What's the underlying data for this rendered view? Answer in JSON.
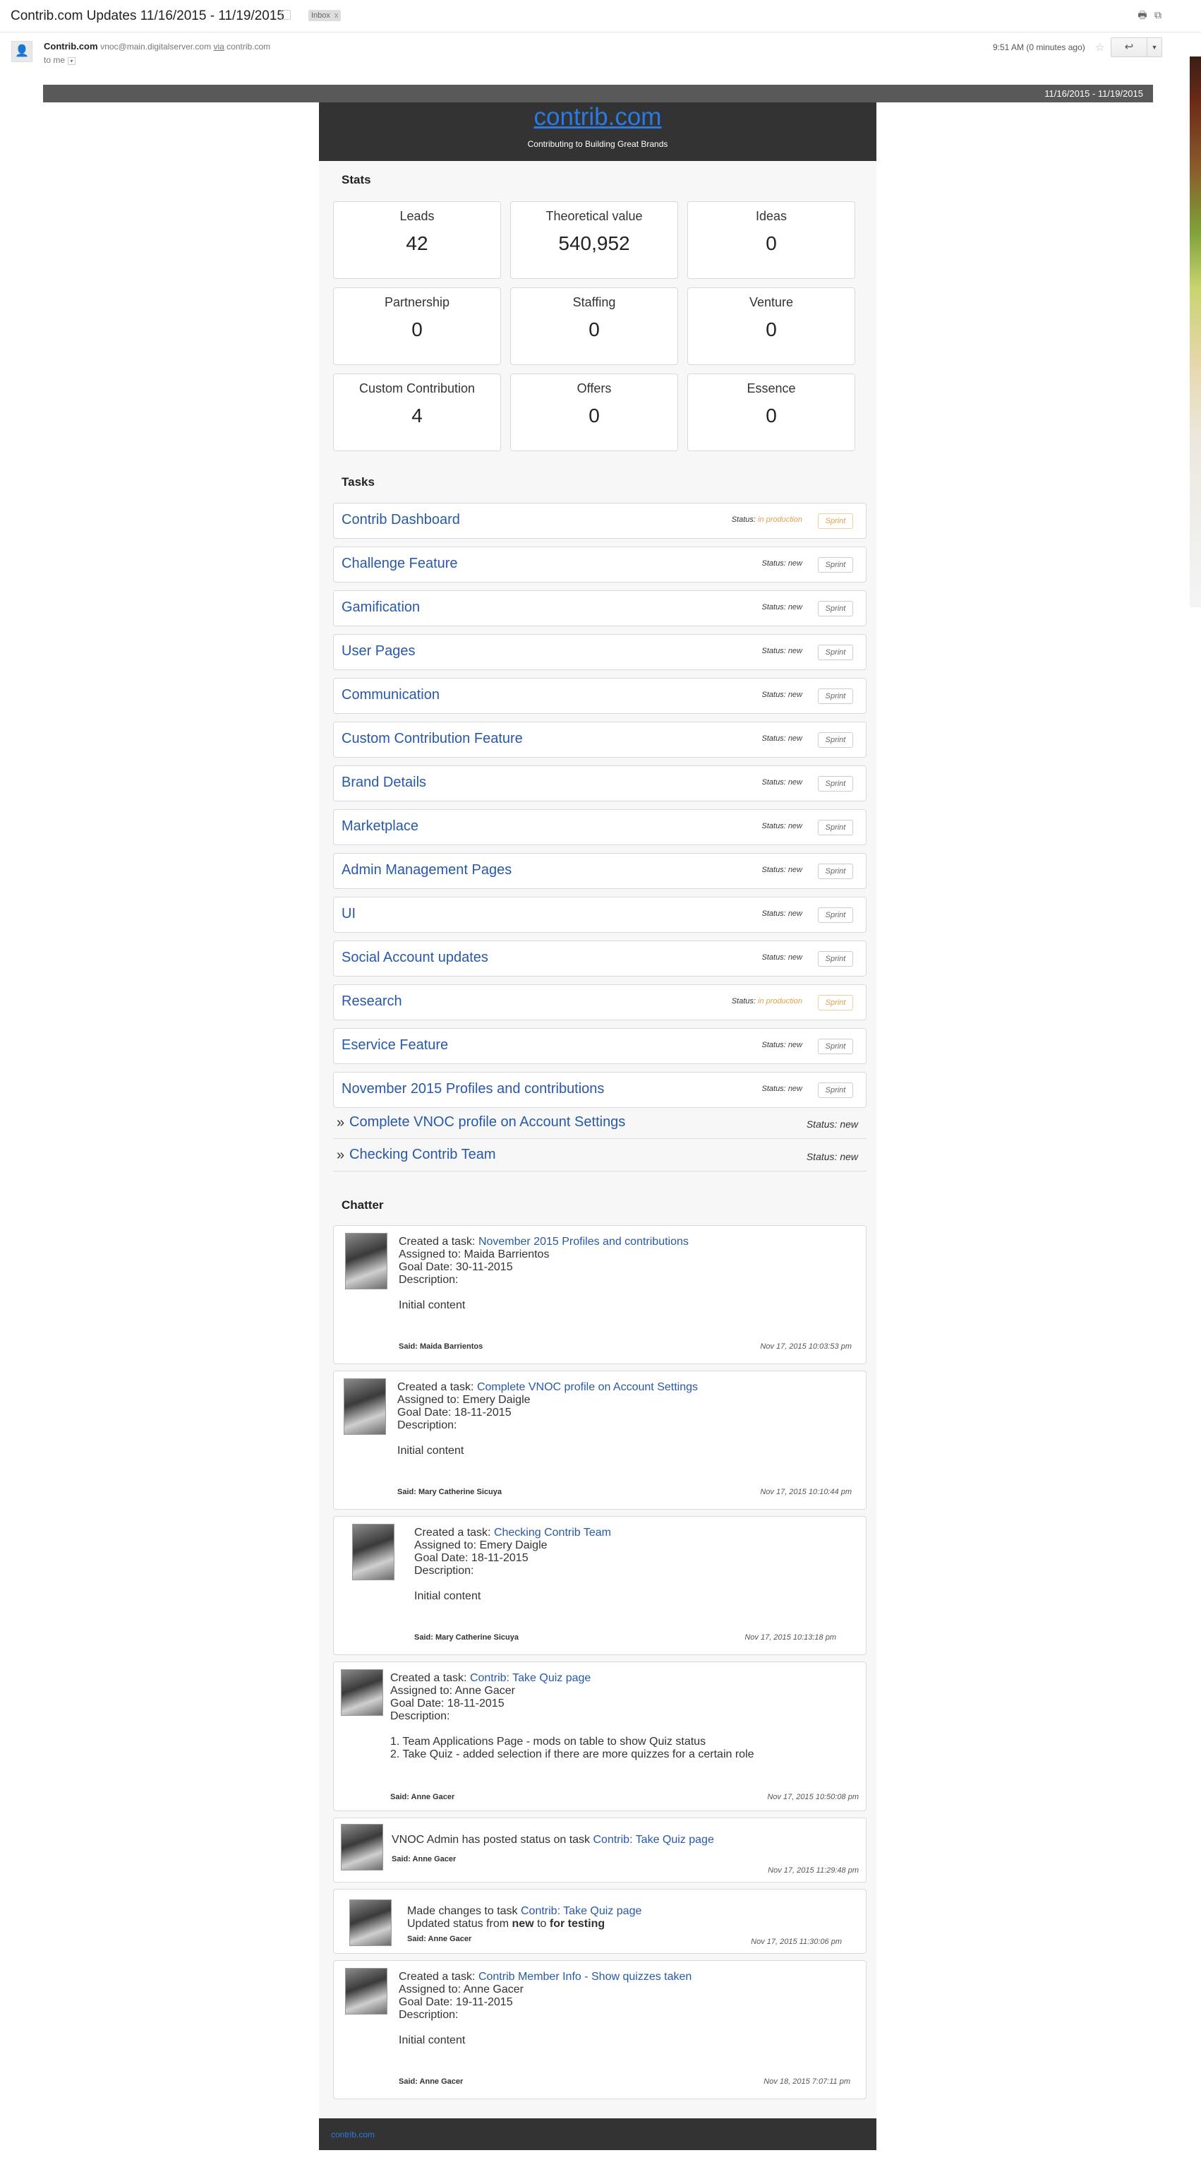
{
  "window": {
    "subject": "Contrib.com Updates 11/16/2015 - 11/19/2015",
    "label": "Inbox",
    "label_close": "x"
  },
  "sender": {
    "name": "Contrib.com",
    "email": "vnoc@main.digitalserver.com",
    "via": "via",
    "via_domain": "contrib.com",
    "to": "to me",
    "time": "9:51 AM (0 minutes ago)"
  },
  "email": {
    "date_range": "11/16/2015 - 11/19/2015",
    "brand": "contrib.com",
    "tagline": "Contributing to Building Great Brands",
    "footer_link": "contrib.com"
  },
  "stats": {
    "title": "Stats",
    "items": [
      {
        "label": "Leads",
        "value": "42"
      },
      {
        "label": "Theoretical value",
        "value": "540,952"
      },
      {
        "label": "Ideas",
        "value": "0"
      },
      {
        "label": "Partnership",
        "value": "0"
      },
      {
        "label": "Staffing",
        "value": "0"
      },
      {
        "label": "Venture",
        "value": "0"
      },
      {
        "label": "Custom Contribution",
        "value": "4"
      },
      {
        "label": "Offers",
        "value": "0"
      },
      {
        "label": "Essence",
        "value": "0"
      }
    ]
  },
  "tasks": {
    "title": "Tasks",
    "status_label": "Status:",
    "items": [
      {
        "title": "Contrib Dashboard",
        "status": "in production",
        "badge": "Sprint"
      },
      {
        "title": "Challenge Feature",
        "status": "new",
        "badge": "Sprint"
      },
      {
        "title": "Gamification",
        "status": "new",
        "badge": "Sprint"
      },
      {
        "title": "User Pages",
        "status": "new",
        "badge": "Sprint"
      },
      {
        "title": "Communication",
        "status": "new",
        "badge": "Sprint"
      },
      {
        "title": "Custom Contribution Feature",
        "status": "new",
        "badge": "Sprint"
      },
      {
        "title": "Brand Details",
        "status": "new",
        "badge": "Sprint"
      },
      {
        "title": "Marketplace",
        "status": "new",
        "badge": "Sprint"
      },
      {
        "title": "Admin Management Pages",
        "status": "new",
        "badge": "Sprint"
      },
      {
        "title": "UI",
        "status": "new",
        "badge": "Sprint"
      },
      {
        "title": "Social Account updates",
        "status": "new",
        "badge": "Sprint"
      },
      {
        "title": "Research",
        "status": "in production",
        "badge": "Sprint"
      },
      {
        "title": "Eservice Feature",
        "status": "new",
        "badge": "Sprint"
      },
      {
        "title": "November 2015 Profiles and contributions",
        "status": "new",
        "badge": "Sprint"
      }
    ],
    "subtasks": [
      {
        "arrow": "»",
        "title": "Complete VNOC profile on Account Settings",
        "status": "Status: new"
      },
      {
        "arrow": "»",
        "title": "Checking Contrib Team",
        "status": "Status: new"
      }
    ]
  },
  "chatter": {
    "title": "Chatter",
    "items": [
      {
        "prefix": "Created a task:",
        "link": "November 2015 Profiles and contributions",
        "assigned": "Assigned to: Maida Barrientos",
        "goal": "Goal Date: 30-11-2015",
        "desc_label": "Description:",
        "desc": "Initial content",
        "said": "Said: Maida Barrientos",
        "time": "Nov 17, 2015 10:03:53 pm"
      },
      {
        "prefix": "Created a task:",
        "link": "Complete VNOC profile on Account Settings",
        "assigned": "Assigned to: Emery Daigle",
        "goal": "Goal Date: 18-11-2015",
        "desc_label": "Description:",
        "desc": "Initial content",
        "said": "Said: Mary Catherine Sicuya",
        "time": "Nov 17, 2015 10:10:44 pm"
      },
      {
        "prefix": "Created a task:",
        "link": "Checking Contrib Team",
        "assigned": "Assigned to: Emery Daigle",
        "goal": "Goal Date: 18-11-2015",
        "desc_label": "Description:",
        "desc": "Initial content",
        "said": "Said: Mary Catherine Sicuya",
        "time": "Nov 17, 2015 10:13:18 pm"
      },
      {
        "prefix": "Created a task:",
        "link": "Contrib: Take Quiz page",
        "assigned": "Assigned to: Anne Gacer",
        "goal": "Goal Date: 18-11-2015",
        "desc_label": "Description:",
        "desc_line1": "1. Team Applications Page - mods on table to show Quiz status",
        "desc_line2": "2. Take Quiz - added selection if there are more quizzes for a certain role",
        "said": "Said: Anne Gacer",
        "time": "Nov 17, 2015 10:50:08 pm"
      },
      {
        "prefix": "VNOC Admin has posted status on task",
        "link": "Contrib: Take Quiz page",
        "said": "Said: Anne Gacer",
        "time": "Nov 17, 2015 11:29:48 pm"
      },
      {
        "prefix": "Made changes to task",
        "link": "Contrib: Take Quiz page",
        "update_prefix": "Updated status from",
        "from": "new",
        "to_word": "to",
        "to": "for testing",
        "said": "Said: Anne Gacer",
        "time": "Nov 17, 2015 11:30:06 pm"
      },
      {
        "prefix": "Created a task:",
        "link": "Contrib Member Info - Show quizzes taken",
        "assigned": "Assigned to: Anne Gacer",
        "goal": "Goal Date: 19-11-2015",
        "desc_label": "Description:",
        "desc": "Initial content",
        "said": "Said: Anne Gacer",
        "time": "Nov 18, 2015 7:07:11 pm"
      }
    ]
  },
  "colors": {
    "link": "#2858a8",
    "header_bg": "#333333",
    "in_production": "#e3a04a"
  }
}
